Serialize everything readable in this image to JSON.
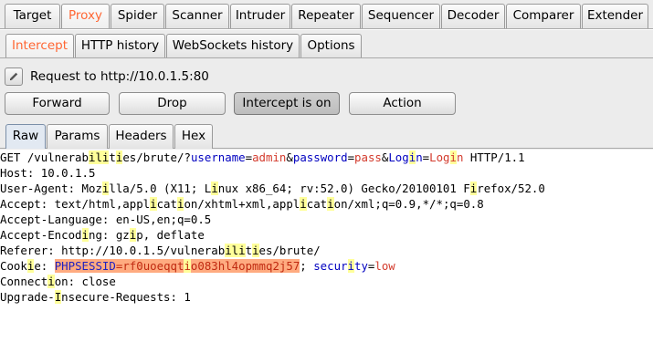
{
  "main_tabs": [
    {
      "label": "Target",
      "active": false
    },
    {
      "label": "Proxy",
      "active": true
    },
    {
      "label": "Spider",
      "active": false
    },
    {
      "label": "Scanner",
      "active": false
    },
    {
      "label": "Intruder",
      "active": false
    },
    {
      "label": "Repeater",
      "active": false
    },
    {
      "label": "Sequencer",
      "active": false
    },
    {
      "label": "Decoder",
      "active": false
    },
    {
      "label": "Comparer",
      "active": false
    },
    {
      "label": "Extender",
      "active": false
    }
  ],
  "proxy_tabs": [
    {
      "label": "Intercept",
      "active": true
    },
    {
      "label": "HTTP history",
      "active": false
    },
    {
      "label": "WebSockets history",
      "active": false
    },
    {
      "label": "Options",
      "active": false
    }
  ],
  "request_to": "Request to http://10.0.1.5:80",
  "buttons": {
    "forward": "Forward",
    "drop": "Drop",
    "intercept": "Intercept is on",
    "action": "Action"
  },
  "view_tabs": [
    {
      "label": "Raw",
      "active": true
    },
    {
      "label": "Params",
      "active": false
    },
    {
      "label": "Headers",
      "active": false
    },
    {
      "label": "Hex",
      "active": false
    }
  ],
  "colors": {
    "active_tab_text": "#ff6633",
    "param_name": "#0000c0",
    "param_value": "#d33a2c",
    "highlight": "#ffff9a",
    "cookie_highlight": "#ffab80"
  },
  "request": {
    "l1": [
      "GET /vulnerab",
      "i",
      "l",
      "i",
      "t",
      "i",
      "es/brute/?",
      "username",
      "=",
      "admin",
      "&",
      "password",
      "=",
      "pass",
      "&",
      "Log",
      "i",
      "n",
      "=",
      "Log",
      "i",
      "n",
      " HTTP/1.1"
    ],
    "l2": "Host: 10.0.1.5",
    "l3": [
      "User-Agent: Moz",
      "i",
      "lla/5.0 (X11; L",
      "i",
      "nux x86_64; rv:52.0) Gecko/20100101 F",
      "i",
      "refox/52.0"
    ],
    "l4": [
      "Accept: text/html,appl",
      "i",
      "cat",
      "i",
      "on/xhtml+xml,appl",
      "i",
      "cat",
      "i",
      "on/xml;q=0.9,*/*;q=0.8"
    ],
    "l5": "Accept-Language: en-US,en;q=0.5",
    "l6": [
      "Accept-Encod",
      "i",
      "ng: gz",
      "i",
      "p, deflate"
    ],
    "l7": [
      "Referer: http://10.0.1.5/vulnerab",
      "i",
      "l",
      "i",
      "t",
      "i",
      "es/brute/"
    ],
    "l8": [
      "Cook",
      "i",
      "e: ",
      "PHPSESSID",
      "=",
      "rf0uoeqqt",
      "i",
      "o083hl4opmmq2j57",
      "; ",
      "secur",
      "i",
      "ty",
      "=",
      "low"
    ],
    "l9": [
      "Connect",
      "i",
      "on: close"
    ],
    "l10": [
      "Upgrade-",
      "I",
      "nsecure-Requests: 1"
    ]
  }
}
